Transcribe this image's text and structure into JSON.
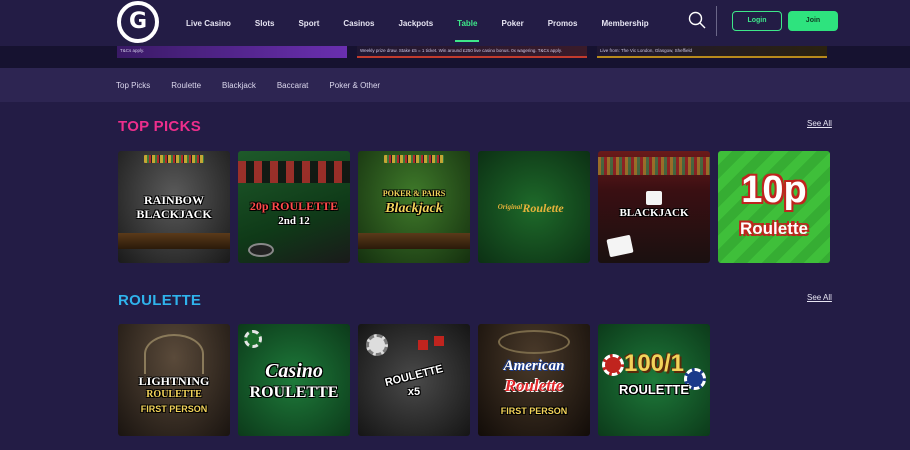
{
  "header": {
    "logo_letter": "G",
    "nav": [
      {
        "label": "Live Casino",
        "active": false
      },
      {
        "label": "Slots",
        "active": false
      },
      {
        "label": "Sport",
        "active": false
      },
      {
        "label": "Casinos",
        "active": false
      },
      {
        "label": "Jackpots",
        "active": false
      },
      {
        "label": "Table",
        "active": true
      },
      {
        "label": "Poker",
        "active": false
      },
      {
        "label": "Promos",
        "active": false
      },
      {
        "label": "Membership",
        "active": false
      }
    ],
    "login_label": "Login",
    "join_label": "Join",
    "accent": "#3ee88a"
  },
  "promos": {
    "p1": "T&Cs apply.",
    "p2": "Weekly prize draw. Stake £5 = 1 ticket. Win around £250 live casino bonus. 0x wagering. T&Cs apply.",
    "p3": "Live from: The Vic London, Glasgow, Sheffield"
  },
  "subnav": [
    "Top Picks",
    "Roulette",
    "Blackjack",
    "Baccarat",
    "Poker & Other"
  ],
  "sections": {
    "top_picks": {
      "title": "TOP PICKS",
      "title_color": "#ee2e8c",
      "see_all": "See All",
      "games": [
        {
          "line1": "RAINBOW",
          "line2": "BLACKJACK"
        },
        {
          "line1": "20p ROULETTE",
          "line2": "2nd 12"
        },
        {
          "line1": "POKER & PAIRS",
          "line2": "Blackjack"
        },
        {
          "line1": "Original",
          "line2": "Roulette"
        },
        {
          "line1": "BLACKJACK",
          "line2": ""
        },
        {
          "line1": "10p",
          "line2": "Roulette"
        }
      ]
    },
    "roulette": {
      "title": "ROULETTE",
      "title_color": "#2fb3ec",
      "see_all": "See All",
      "games": [
        {
          "line1": "LIGHTNING",
          "line2": "ROULETTE",
          "line3": "FIRST PERSON"
        },
        {
          "line1": "Casino",
          "line2": "ROULETTE",
          "line3": ""
        },
        {
          "line1": "ROULETTE",
          "line2": "x5",
          "line3": ""
        },
        {
          "line1": "American",
          "line2": "Roulette",
          "line3": "FIRST PERSON"
        },
        {
          "line1": "100/1",
          "line2": "ROULETTE",
          "line3": ""
        }
      ]
    }
  }
}
